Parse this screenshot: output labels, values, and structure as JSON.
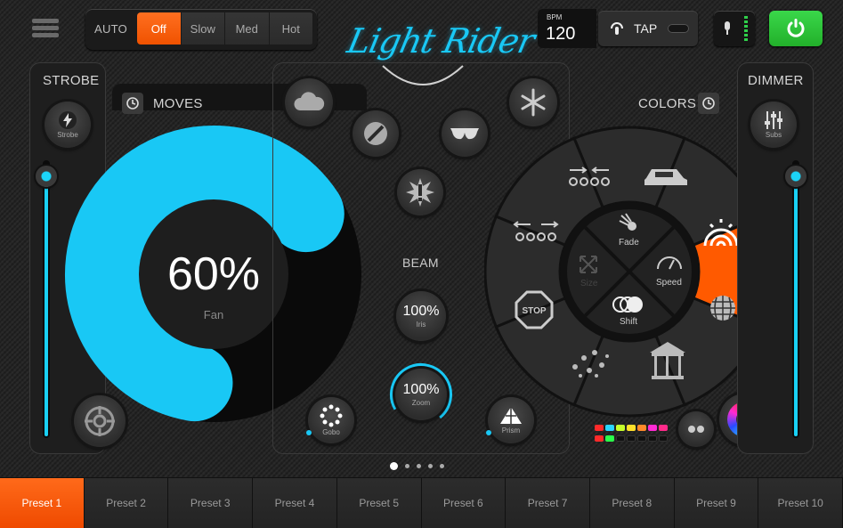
{
  "app": {
    "logo_text": "Light Rider"
  },
  "top": {
    "menu_icon": "hamburger-icon",
    "mode_label": "AUTO",
    "modes": [
      {
        "label": "Off",
        "active": true
      },
      {
        "label": "Slow",
        "active": false
      },
      {
        "label": "Med",
        "active": false
      },
      {
        "label": "Hot",
        "active": false
      }
    ],
    "bpm_label": "BPM",
    "bpm_value": "120",
    "tap_label": "TAP",
    "mic_icon": "microphone-icon",
    "power_icon": "power-icon",
    "power_color": "#2fc83a"
  },
  "strobe": {
    "label": "STROBE",
    "button_label": "Strobe",
    "level": 0.98
  },
  "dimmer": {
    "label": "DIMMER",
    "button_label": "Subs",
    "level": 0.98
  },
  "moves": {
    "label": "MOVES",
    "value": "60%",
    "mode": "Fan",
    "level": 0.6,
    "accent": "#19c8f5"
  },
  "beam": {
    "label": "BEAM",
    "iris": {
      "value": "100%",
      "label": "Iris"
    },
    "zoom": {
      "value": "100%",
      "label": "Zoom"
    },
    "gobo_label": "Gobo",
    "prism_label": "Prism"
  },
  "colors": {
    "label": "COLORS",
    "inner": {
      "fade": "Fade",
      "speed": "Speed",
      "shift": "Shift",
      "size": "Size"
    },
    "active_segment": "rainbow",
    "accent": "#ff5a00",
    "swatches_row1": [
      "#ff2a2a",
      "#2ad4ff",
      "#c6ff2a",
      "#ffe02a",
      "#ff8a2a",
      "#ff2ad4",
      "#ff2a8a"
    ],
    "swatches_row2": [
      "#ff2a2a",
      "#2aff4a",
      "#111111",
      "#111111",
      "#111111",
      "#111111",
      "#111111"
    ]
  },
  "pager": {
    "count": 5,
    "active": 0
  },
  "presets": [
    "Preset 1",
    "Preset 2",
    "Preset 3",
    "Preset 4",
    "Preset 5",
    "Preset 6",
    "Preset 7",
    "Preset 8",
    "Preset 9",
    "Preset 10"
  ]
}
